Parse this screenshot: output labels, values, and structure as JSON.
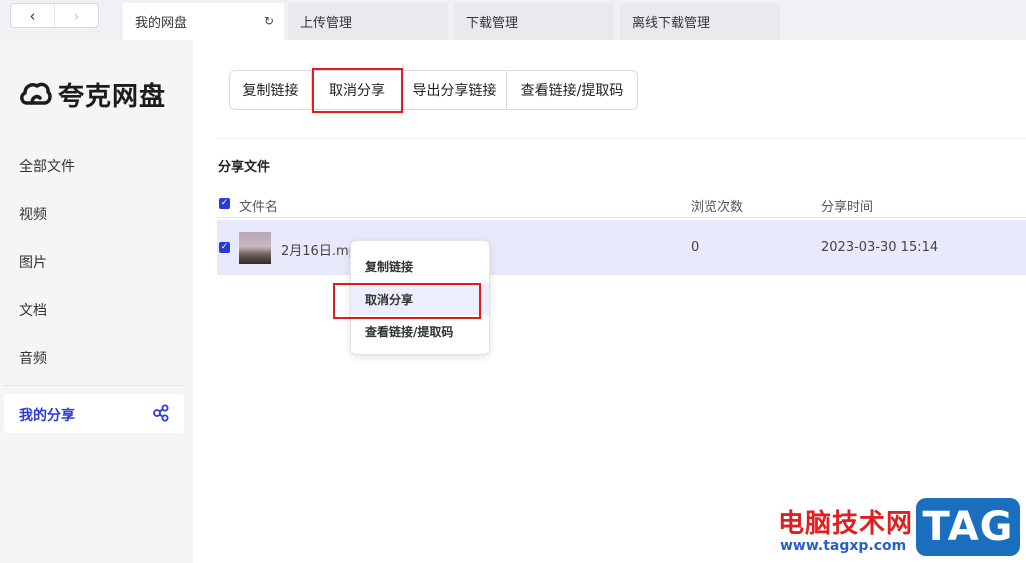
{
  "nav": {
    "back": "‹",
    "forward": "›"
  },
  "tabs": [
    {
      "label": "我的网盘",
      "refresh_icon": "↻"
    },
    {
      "label": "上传管理"
    },
    {
      "label": "下载管理"
    },
    {
      "label": "离线下载管理"
    }
  ],
  "sidebar": {
    "logo_text": "夸克网盘",
    "items": [
      {
        "label": "全部文件"
      },
      {
        "label": "视频"
      },
      {
        "label": "图片"
      },
      {
        "label": "文档"
      },
      {
        "label": "音频"
      }
    ],
    "active_item": {
      "label": "我的分享",
      "icon": "share-icon"
    }
  },
  "toolbar": {
    "buttons": [
      {
        "label": "复制链接"
      },
      {
        "label": "取消分享"
      },
      {
        "label": "导出分享链接"
      },
      {
        "label": "查看链接/提取码"
      }
    ]
  },
  "section_title": "分享文件",
  "table": {
    "headers": {
      "name": "文件名",
      "views": "浏览次数",
      "time": "分享时间"
    },
    "rows": [
      {
        "name": "2月16日.mp",
        "views": "0",
        "time": "2023-03-30 15:14",
        "checked": true
      }
    ]
  },
  "context_menu": {
    "items": [
      {
        "label": "复制链接"
      },
      {
        "label": "取消分享"
      },
      {
        "label": "查看链接/提取码"
      }
    ]
  },
  "watermark": {
    "title": "电脑技术网",
    "url": "www.tagxp.com",
    "badge": "TAG"
  },
  "colors": {
    "accent": "#2a3bd6",
    "highlight_box": "#e01b1b",
    "row_selected": "#e8eafb",
    "sidebar_bg": "#f5f5f6"
  }
}
